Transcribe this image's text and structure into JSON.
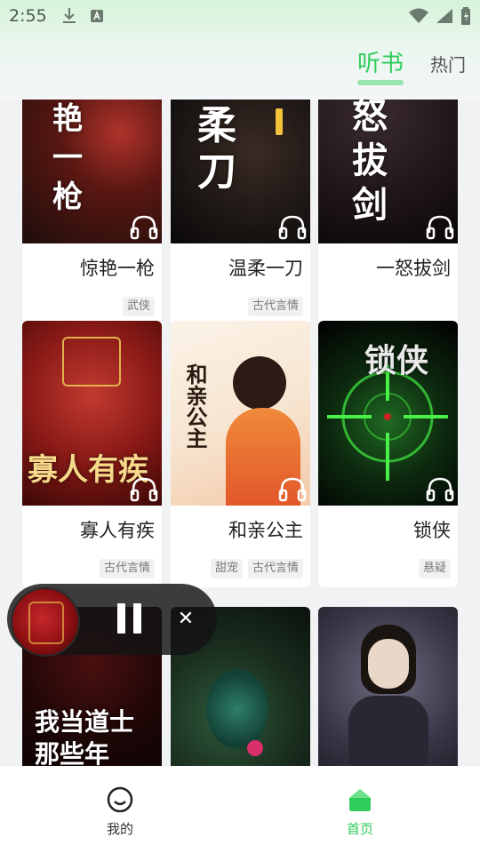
{
  "status": {
    "time": "2:55"
  },
  "header": {
    "tabs": [
      {
        "label": "听书",
        "active": true
      },
      {
        "label": "热门",
        "active": false
      }
    ]
  },
  "books": [
    {
      "title": "惊艳一枪",
      "tags": [
        "武侠"
      ],
      "cover_text": "艳\n一\n枪"
    },
    {
      "title": "温柔一刀",
      "tags": [
        "古代言情"
      ],
      "cover_text": "柔\n刀"
    },
    {
      "title": "一怒拔剑",
      "tags": [],
      "cover_text": "怒\n拔\n剑"
    },
    {
      "title": "寡人有疾",
      "tags": [
        "古代言情"
      ],
      "cover_text": "寡人有疾"
    },
    {
      "title": "和亲公主",
      "tags": [
        "甜宠",
        "古代言情"
      ],
      "cover_text": "和亲公主"
    },
    {
      "title": "锁侠",
      "tags": [
        "悬疑"
      ],
      "cover_text": "锁侠"
    },
    {
      "title": "",
      "tags": [],
      "cover_text": "我当道士那些年"
    },
    {
      "title": "",
      "tags": [],
      "cover_text": ""
    },
    {
      "title": "",
      "tags": [],
      "cover_text": ""
    }
  ],
  "mini_player": {
    "state": "playing"
  },
  "bottom_nav": {
    "items": [
      {
        "label": "我的",
        "active": false
      },
      {
        "label": "首页",
        "active": true
      }
    ]
  },
  "colors": {
    "accent": "#2ecc5a"
  }
}
